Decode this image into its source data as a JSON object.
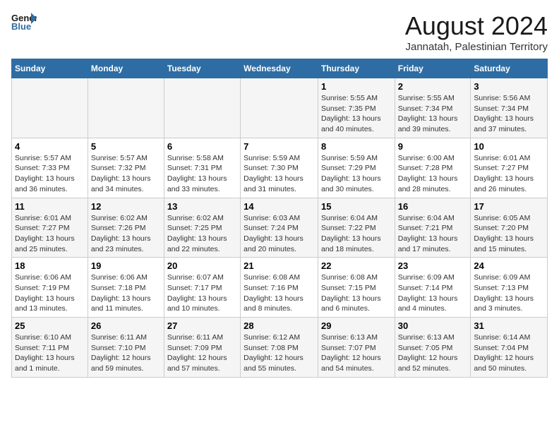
{
  "header": {
    "logo_line1": "General",
    "logo_line2": "Blue",
    "main_title": "August 2024",
    "subtitle": "Jannatah, Palestinian Territory"
  },
  "days_of_week": [
    "Sunday",
    "Monday",
    "Tuesday",
    "Wednesday",
    "Thursday",
    "Friday",
    "Saturday"
  ],
  "weeks": [
    [
      {
        "num": "",
        "info": ""
      },
      {
        "num": "",
        "info": ""
      },
      {
        "num": "",
        "info": ""
      },
      {
        "num": "",
        "info": ""
      },
      {
        "num": "1",
        "info": "Sunrise: 5:55 AM\nSunset: 7:35 PM\nDaylight: 13 hours\nand 40 minutes."
      },
      {
        "num": "2",
        "info": "Sunrise: 5:55 AM\nSunset: 7:34 PM\nDaylight: 13 hours\nand 39 minutes."
      },
      {
        "num": "3",
        "info": "Sunrise: 5:56 AM\nSunset: 7:34 PM\nDaylight: 13 hours\nand 37 minutes."
      }
    ],
    [
      {
        "num": "4",
        "info": "Sunrise: 5:57 AM\nSunset: 7:33 PM\nDaylight: 13 hours\nand 36 minutes."
      },
      {
        "num": "5",
        "info": "Sunrise: 5:57 AM\nSunset: 7:32 PM\nDaylight: 13 hours\nand 34 minutes."
      },
      {
        "num": "6",
        "info": "Sunrise: 5:58 AM\nSunset: 7:31 PM\nDaylight: 13 hours\nand 33 minutes."
      },
      {
        "num": "7",
        "info": "Sunrise: 5:59 AM\nSunset: 7:30 PM\nDaylight: 13 hours\nand 31 minutes."
      },
      {
        "num": "8",
        "info": "Sunrise: 5:59 AM\nSunset: 7:29 PM\nDaylight: 13 hours\nand 30 minutes."
      },
      {
        "num": "9",
        "info": "Sunrise: 6:00 AM\nSunset: 7:28 PM\nDaylight: 13 hours\nand 28 minutes."
      },
      {
        "num": "10",
        "info": "Sunrise: 6:01 AM\nSunset: 7:27 PM\nDaylight: 13 hours\nand 26 minutes."
      }
    ],
    [
      {
        "num": "11",
        "info": "Sunrise: 6:01 AM\nSunset: 7:27 PM\nDaylight: 13 hours\nand 25 minutes."
      },
      {
        "num": "12",
        "info": "Sunrise: 6:02 AM\nSunset: 7:26 PM\nDaylight: 13 hours\nand 23 minutes."
      },
      {
        "num": "13",
        "info": "Sunrise: 6:02 AM\nSunset: 7:25 PM\nDaylight: 13 hours\nand 22 minutes."
      },
      {
        "num": "14",
        "info": "Sunrise: 6:03 AM\nSunset: 7:24 PM\nDaylight: 13 hours\nand 20 minutes."
      },
      {
        "num": "15",
        "info": "Sunrise: 6:04 AM\nSunset: 7:22 PM\nDaylight: 13 hours\nand 18 minutes."
      },
      {
        "num": "16",
        "info": "Sunrise: 6:04 AM\nSunset: 7:21 PM\nDaylight: 13 hours\nand 17 minutes."
      },
      {
        "num": "17",
        "info": "Sunrise: 6:05 AM\nSunset: 7:20 PM\nDaylight: 13 hours\nand 15 minutes."
      }
    ],
    [
      {
        "num": "18",
        "info": "Sunrise: 6:06 AM\nSunset: 7:19 PM\nDaylight: 13 hours\nand 13 minutes."
      },
      {
        "num": "19",
        "info": "Sunrise: 6:06 AM\nSunset: 7:18 PM\nDaylight: 13 hours\nand 11 minutes."
      },
      {
        "num": "20",
        "info": "Sunrise: 6:07 AM\nSunset: 7:17 PM\nDaylight: 13 hours\nand 10 minutes."
      },
      {
        "num": "21",
        "info": "Sunrise: 6:08 AM\nSunset: 7:16 PM\nDaylight: 13 hours\nand 8 minutes."
      },
      {
        "num": "22",
        "info": "Sunrise: 6:08 AM\nSunset: 7:15 PM\nDaylight: 13 hours\nand 6 minutes."
      },
      {
        "num": "23",
        "info": "Sunrise: 6:09 AM\nSunset: 7:14 PM\nDaylight: 13 hours\nand 4 minutes."
      },
      {
        "num": "24",
        "info": "Sunrise: 6:09 AM\nSunset: 7:13 PM\nDaylight: 13 hours\nand 3 minutes."
      }
    ],
    [
      {
        "num": "25",
        "info": "Sunrise: 6:10 AM\nSunset: 7:11 PM\nDaylight: 13 hours\nand 1 minute."
      },
      {
        "num": "26",
        "info": "Sunrise: 6:11 AM\nSunset: 7:10 PM\nDaylight: 12 hours\nand 59 minutes."
      },
      {
        "num": "27",
        "info": "Sunrise: 6:11 AM\nSunset: 7:09 PM\nDaylight: 12 hours\nand 57 minutes."
      },
      {
        "num": "28",
        "info": "Sunrise: 6:12 AM\nSunset: 7:08 PM\nDaylight: 12 hours\nand 55 minutes."
      },
      {
        "num": "29",
        "info": "Sunrise: 6:13 AM\nSunset: 7:07 PM\nDaylight: 12 hours\nand 54 minutes."
      },
      {
        "num": "30",
        "info": "Sunrise: 6:13 AM\nSunset: 7:05 PM\nDaylight: 12 hours\nand 52 minutes."
      },
      {
        "num": "31",
        "info": "Sunrise: 6:14 AM\nSunset: 7:04 PM\nDaylight: 12 hours\nand 50 minutes."
      }
    ]
  ]
}
